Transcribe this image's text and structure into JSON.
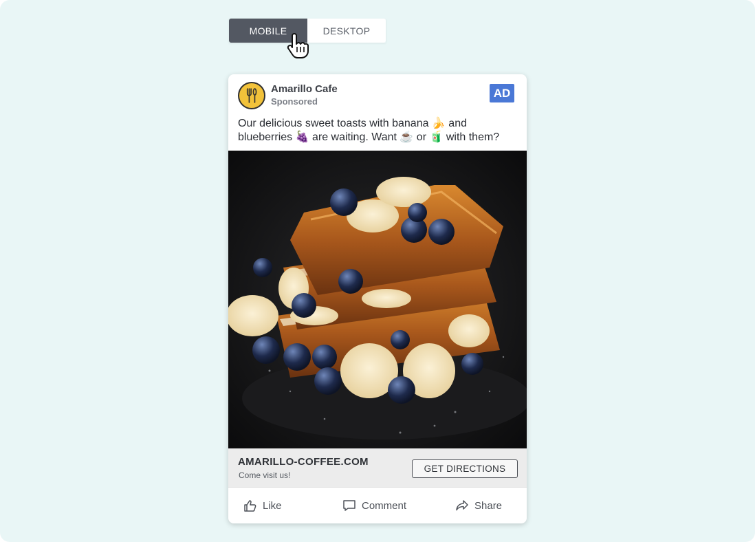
{
  "toggle": {
    "mobile_label": "MOBILE",
    "desktop_label": "DESKTOP",
    "selected": "MOBILE"
  },
  "ad": {
    "page_name": "Amarillo Cafe",
    "sponsored_label": "Sponsored",
    "badge": "AD",
    "caption_line1": "Our delicious sweet toasts with banana 🍌 and",
    "caption_line2": "blueberries 🍇 are waiting. Want ☕ or 🧃 with them?",
    "image_subject": "french toast with bananas and blueberries",
    "domain": "AMARILLO-COFFEE.COM",
    "cta_subtext": "Come visit us!",
    "cta_button": "GET DIRECTIONS"
  },
  "actions": {
    "like": "Like",
    "comment": "Comment",
    "share": "Share"
  },
  "colors": {
    "toggle_active": "#535862",
    "badge": "#4a78d6",
    "background": "#e9f6f6"
  }
}
